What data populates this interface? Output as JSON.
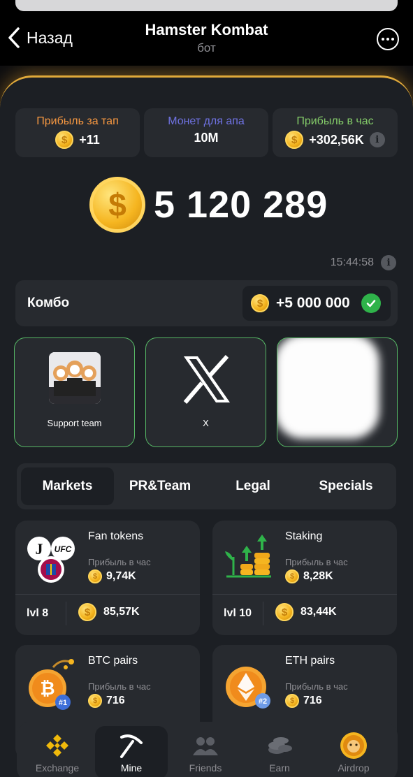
{
  "header": {
    "back_label": "Назад",
    "title": "Hamster Kombat",
    "subtitle": "бот"
  },
  "stats": [
    {
      "label": "Прибыль за тап",
      "value": "+11",
      "color": "#f79841"
    },
    {
      "label": "Монет для апа",
      "value": "10M",
      "color": "#6f72e2"
    },
    {
      "label": "Прибыль в час",
      "value": "+302,56K",
      "color": "#84cb69"
    }
  ],
  "balance": "5 120 289",
  "timer": "15:44:58",
  "combo": {
    "label": "Комбо",
    "value": "+5 000 000"
  },
  "combo_cards": [
    {
      "caption": "Support team"
    },
    {
      "caption": "X"
    }
  ],
  "tabs": [
    "Markets",
    "PR&Team",
    "Legal",
    "Specials"
  ],
  "upgrades": [
    {
      "name": "Fan tokens",
      "profit_label": "Прибыль в час",
      "profit": "9,74K",
      "level": "lvl 8",
      "cost": "85,57K",
      "icon": "fan-tokens-icon"
    },
    {
      "name": "Staking",
      "profit_label": "Прибыль в час",
      "profit": "8,28K",
      "level": "lvl 10",
      "cost": "83,44K",
      "icon": "staking-icon"
    },
    {
      "name": "BTC pairs",
      "profit_label": "Прибыль в час",
      "profit": "716",
      "badge": "#1",
      "icon": "btc-icon"
    },
    {
      "name": "ETH pairs",
      "profit_label": "Прибыль в час",
      "profit": "716",
      "badge": "#2",
      "icon": "eth-icon"
    }
  ],
  "nav": [
    "Exchange",
    "Mine",
    "Friends",
    "Earn",
    "Airdrop"
  ],
  "colors": {
    "accent_gold": "#f3b21c",
    "success_green": "#2fb34a",
    "card_bg": "#272a2f",
    "panel_bg": "#1c1f24"
  }
}
